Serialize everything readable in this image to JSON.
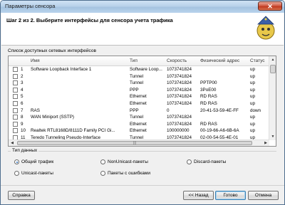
{
  "window": {
    "title": "Параметры сенсора",
    "close_label": "✕"
  },
  "header": {
    "step_text": "Шаг 2 из 2. Выберите интерфейсы для сенсора учета трафика"
  },
  "list": {
    "label": "Список доступных сетевых интерфейсов",
    "columns": [
      "Имя",
      "Тип",
      "Скорость",
      "Физический адрес",
      "Статус"
    ],
    "rows": [
      {
        "idx": "1",
        "name": "Software Loopback Interface 1",
        "type": "Software Loop...",
        "speed": "1073741824",
        "mac": "",
        "status": "up"
      },
      {
        "idx": "2",
        "name": "",
        "type": "Tunnel",
        "speed": "1073741824",
        "mac": "",
        "status": "up"
      },
      {
        "idx": "3",
        "name": "",
        "type": "Tunnel",
        "speed": "1073741824",
        "mac": "PPTP00",
        "status": "up"
      },
      {
        "idx": "4",
        "name": "",
        "type": "PPP",
        "speed": "1073741824",
        "mac": "3PoE00",
        "status": "up"
      },
      {
        "idx": "5",
        "name": "",
        "type": "Ethernet",
        "speed": "1073741824",
        "mac": "RD RAS",
        "status": "up"
      },
      {
        "idx": "6",
        "name": "",
        "type": "Ethernet",
        "speed": "1073741824",
        "mac": "RD RAS",
        "status": "up"
      },
      {
        "idx": "7",
        "name": "RAS",
        "type": "PPP",
        "speed": "0",
        "mac": "20-41-53-59-4E-FF",
        "status": "down"
      },
      {
        "idx": "8",
        "name": "WAN Miniport (SSTP)",
        "type": "Tunnel",
        "speed": "1073741824",
        "mac": "",
        "status": "up"
      },
      {
        "idx": "9",
        "name": "",
        "type": "Ethernet",
        "speed": "1073741824",
        "mac": "RD RAS",
        "status": "up"
      },
      {
        "idx": "10",
        "name": "Realtek RTL8168D/8111D Family PCI Gi...",
        "type": "Ethernet",
        "speed": "100000000",
        "mac": "00-19-66-A6-6B-6A",
        "status": "up"
      },
      {
        "idx": "11",
        "name": "Teredo Tunneling Pseudo-Interface",
        "type": "Tunnel",
        "speed": "1073741824",
        "mac": "02-00-54-55-4E-01",
        "status": "up"
      }
    ]
  },
  "traffic_type": {
    "legend": "Тип данных",
    "options": [
      {
        "label": "Общий трафик",
        "selected": true
      },
      {
        "label": "NonUnicast-пакеты",
        "selected": false
      },
      {
        "label": "Discard-пакеты",
        "selected": false
      },
      {
        "label": "Unicast-пакеты",
        "selected": false
      },
      {
        "label": "Пакеты с ошибками",
        "selected": false
      }
    ]
  },
  "buttons": {
    "help": "Справка",
    "back": "<< Назад",
    "finish": "Готово",
    "cancel": "Отмена"
  },
  "colors": {
    "titlebar": "#b8d2ea",
    "close": "#c0391f",
    "accent": "#3c7fb1"
  }
}
